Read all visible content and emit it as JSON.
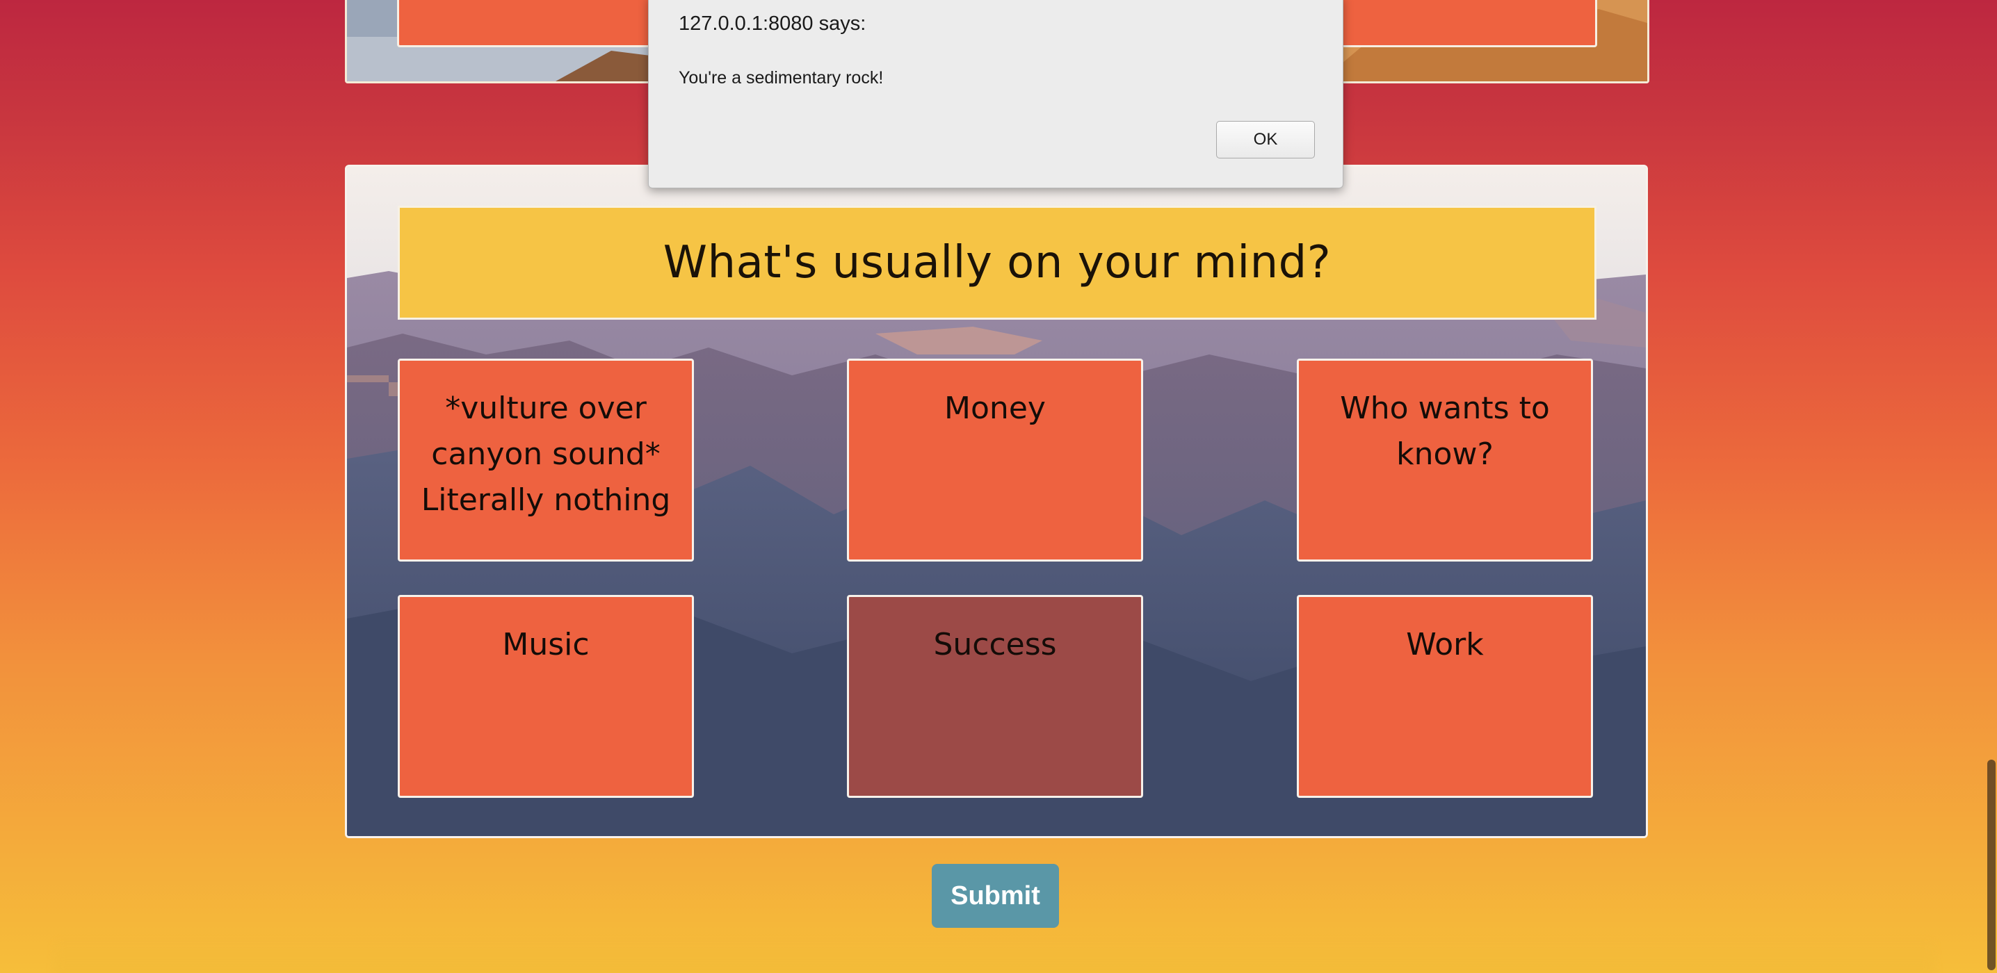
{
  "alert": {
    "origin": "127.0.0.1:8080 says:",
    "message": "You're a sedimentary rock!",
    "ok_label": "OK"
  },
  "question": {
    "title": "What's usually on your mind?",
    "answers": [
      {
        "label": "*vulture over canyon sound* Literally nothing",
        "selected": false
      },
      {
        "label": "Money",
        "selected": false
      },
      {
        "label": "Who wants to know?",
        "selected": false
      },
      {
        "label": "Music",
        "selected": false
      },
      {
        "label": "Success",
        "selected": true
      },
      {
        "label": "Work",
        "selected": false
      }
    ]
  },
  "submit": {
    "label": "Submit"
  },
  "colors": {
    "answer_default": "#ee6240",
    "answer_selected": "#9c4a47",
    "title_box": "#f6c445",
    "submit": "#5a97a7"
  }
}
